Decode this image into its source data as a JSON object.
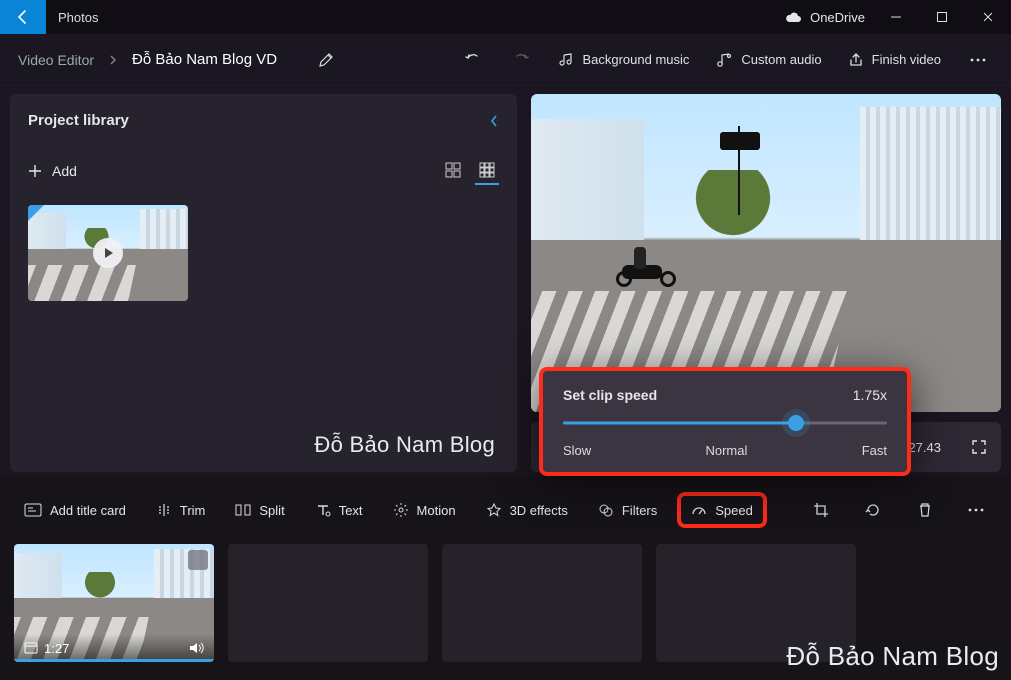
{
  "titlebar": {
    "back": "Back",
    "app": "Photos",
    "onedrive": "OneDrive"
  },
  "breadcrumb": {
    "root": "Video Editor",
    "project": "Đỗ Bảo Nam Blog VD"
  },
  "topactions": {
    "bgmusic": "Background music",
    "customaudio": "Custom audio",
    "finish": "Finish video"
  },
  "library": {
    "title": "Project library",
    "add": "Add"
  },
  "watermark": "Đỗ Bảo Nam Blog",
  "speed_popup": {
    "title": "Set clip speed",
    "value": "1.75x",
    "slow": "Slow",
    "normal": "Normal",
    "fast": "Fast"
  },
  "playbar": {
    "time": "):27.43"
  },
  "toolbar": {
    "title_card": "Add title card",
    "trim": "Trim",
    "split": "Split",
    "text": "Text",
    "motion": "Motion",
    "effects": "3D effects",
    "filters": "Filters",
    "speed": "Speed"
  },
  "timeline": {
    "clip1_duration": "1:27"
  }
}
